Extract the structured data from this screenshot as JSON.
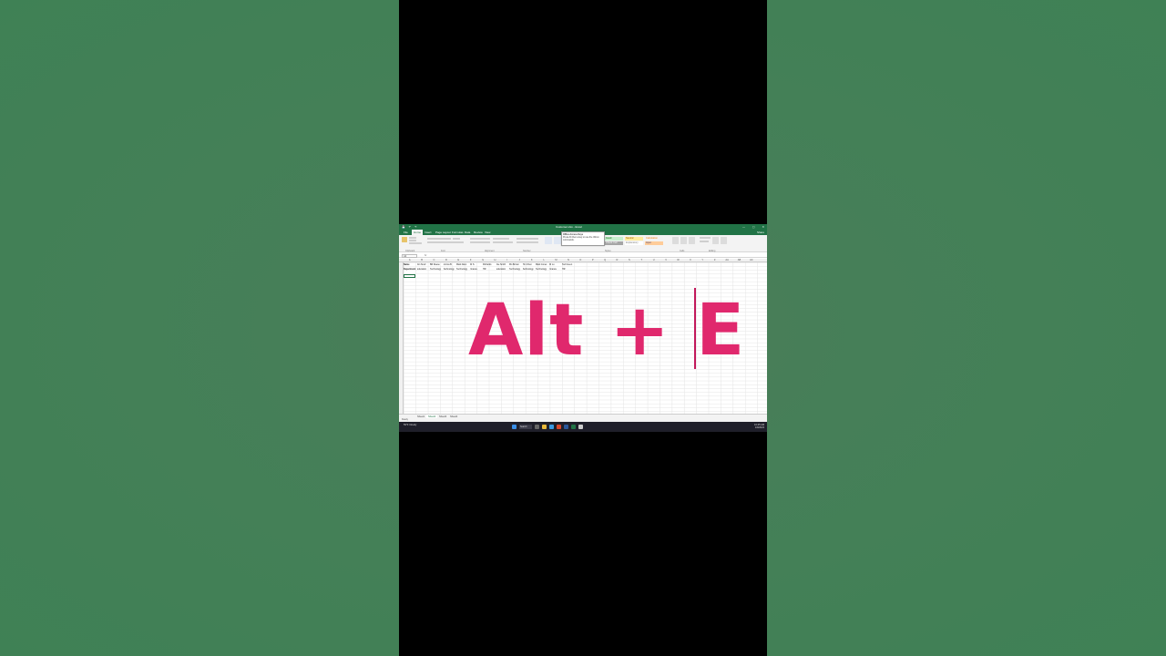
{
  "window": {
    "title": "Customer.xlsx - Excel",
    "qat": [
      "💾",
      "↶",
      "↷"
    ],
    "controls": [
      "—",
      "▢",
      "✕"
    ]
  },
  "ribbon": {
    "tabs": [
      "File",
      "Home",
      "Insert",
      "Page Layout",
      "Formulas",
      "Data",
      "Review",
      "View"
    ],
    "active_tab": "Home",
    "share_label": "Share",
    "styles": [
      {
        "label": "Good",
        "bg": "#c6efce",
        "fg": "#006100"
      },
      {
        "label": "Neutral",
        "bg": "#ffeb9c",
        "fg": "#9c5700"
      },
      {
        "label": "Calculation",
        "bg": "#f2f2f2",
        "fg": "#fa7d00"
      },
      {
        "label": "Check Cell",
        "bg": "#a5a5a5",
        "fg": "#ffffff"
      },
      {
        "label": "Explanatory",
        "bg": "#ffffff",
        "fg": "#7f7f7f"
      },
      {
        "label": "Input",
        "bg": "#ffcc99",
        "fg": "#3f3f76"
      }
    ],
    "group_labels": [
      "Clipboard",
      "Font",
      "Alignment",
      "Number",
      "Styles",
      "Cells",
      "Editing"
    ],
    "tooltip": {
      "title": "Office Access Keys",
      "body": "Press Alt then a key to use the ribbon commands."
    }
  },
  "formula_bar": {
    "name_box": "A3",
    "fx": "fx"
  },
  "sheet": {
    "columns": [
      "A",
      "B",
      "C",
      "D",
      "E",
      "F",
      "G",
      "H",
      "I",
      "J",
      "K",
      "L",
      "M",
      "N",
      "O",
      "P",
      "Q",
      "R",
      "S",
      "T",
      "U",
      "V",
      "W",
      "X",
      "Y",
      "Z",
      "AA",
      "AB",
      "AC"
    ],
    "rows": [
      [
        "Name",
        "Jon Snell",
        "Bill Reese",
        "Emma B.",
        "Mark Allen",
        "Ali S.",
        "Richards",
        "Joe Smith",
        "Mo Brown",
        "Tim Chen",
        "Mark Jones",
        "Ali Lu",
        "Ted Green"
      ],
      [
        "Department",
        "Education",
        "Technology",
        "Technology",
        "Technology",
        "Finance",
        "HR",
        "Education",
        "Technology",
        "Technology",
        "Technology",
        "Finance",
        "HR"
      ]
    ],
    "tabs": [
      "Sheet1",
      "Sheet2",
      "Sheet3",
      "Sheet4"
    ],
    "active_tab": "Sheet2"
  },
  "status": {
    "text": "Ready"
  },
  "overlay": {
    "text": "Alt + E",
    "color": "#e0286d"
  },
  "taskbar": {
    "weather": "59°F Cloudy",
    "search": "Search",
    "time": "10:45 AM",
    "date": "1/9/2023"
  }
}
